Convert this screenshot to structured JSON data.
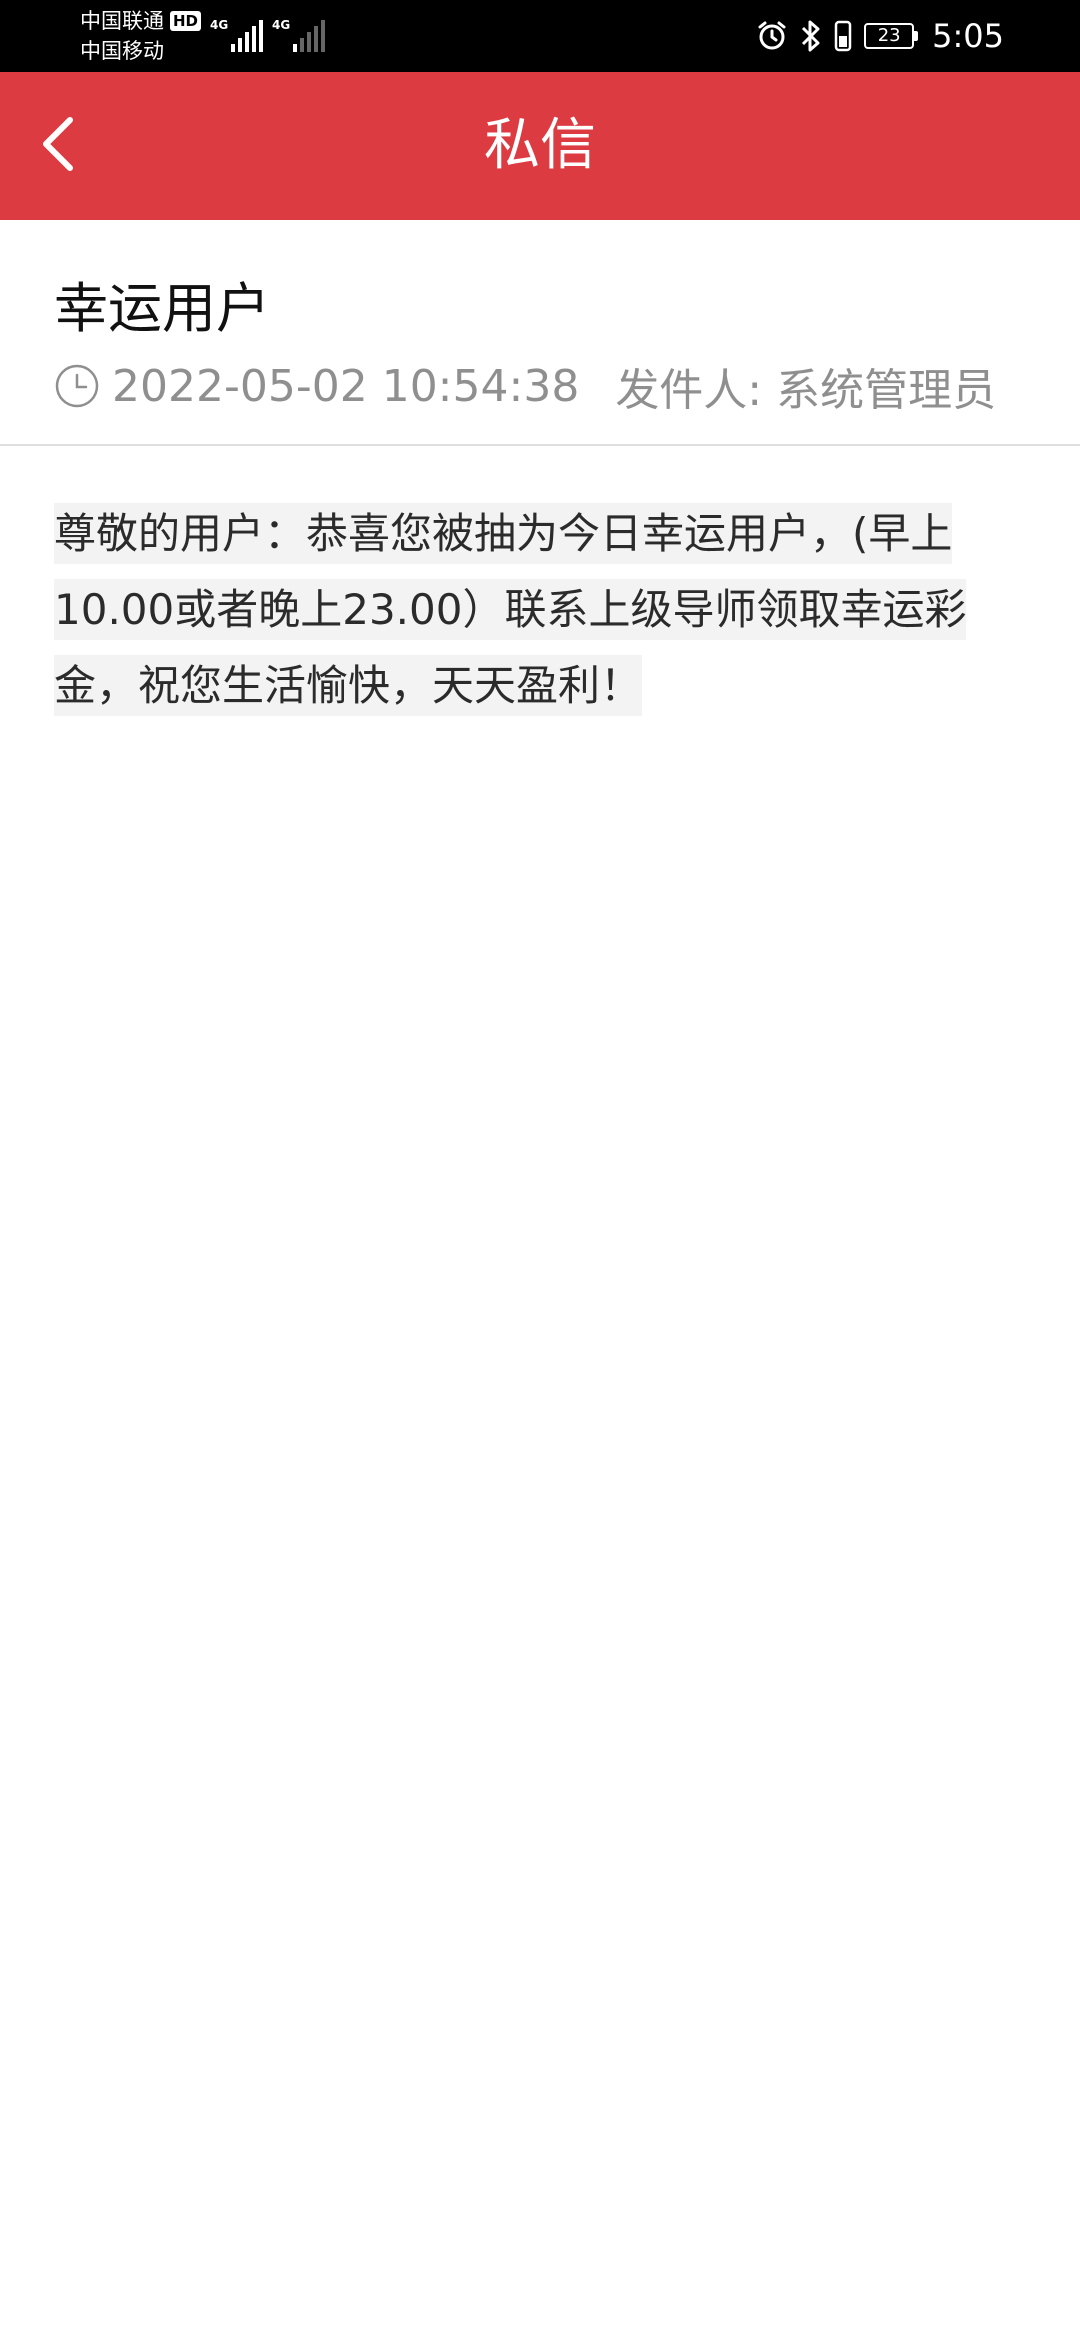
{
  "status_bar": {
    "carrier_1": "中国联通",
    "carrier_1_badge": "HD",
    "carrier_2": "中国移动",
    "network_1": "4G",
    "network_2": "4G",
    "battery_level": "23",
    "time": "5:05",
    "icons": [
      "alarm-icon",
      "bluetooth-icon",
      "vibrate-icon",
      "battery-icon"
    ]
  },
  "app_bar": {
    "title": "私信",
    "back_icon": "chevron-left-icon"
  },
  "message": {
    "title": "幸运用户",
    "timestamp": "2022-05-02 10:54:38",
    "sender": "发件人: 系统管理员",
    "body": "尊敬的用户：恭喜您被抽为今日幸运用户，(早上10.00或者晚上23.00）联系上级导师领取幸运彩金，祝您生活愉快，天天盈利！"
  },
  "colors": {
    "header_red": "#dc3b42",
    "meta_gray": "#8f8f8f",
    "body_text": "#2b2b2b"
  }
}
